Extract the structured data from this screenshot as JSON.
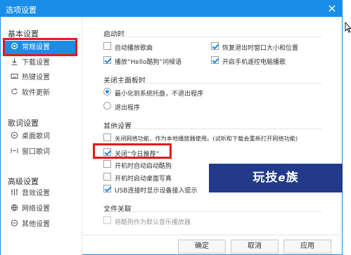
{
  "window": {
    "title": "选项设置"
  },
  "sidebar": {
    "groups": [
      {
        "label": "基本设置",
        "items": [
          {
            "label": "常规设置",
            "icon": "gear-icon",
            "active": true
          },
          {
            "label": "下载设置",
            "icon": "download-icon"
          },
          {
            "label": "热键设置",
            "icon": "keyboard-icon"
          },
          {
            "label": "软件更新",
            "icon": "update-icon"
          }
        ]
      },
      {
        "label": "歌词设置",
        "items": [
          {
            "label": "桌面歌词",
            "icon": "desktop-lyrics-icon"
          },
          {
            "label": "窗口歌词",
            "icon": "window-lyrics-icon"
          }
        ]
      },
      {
        "label": "高级设置",
        "items": [
          {
            "label": "音效设置",
            "icon": "equalizer-icon"
          },
          {
            "label": "网络设置",
            "icon": "network-icon"
          },
          {
            "label": "其他设置",
            "icon": "more-icon"
          }
        ]
      }
    ]
  },
  "main": {
    "startup": {
      "title": "启动时",
      "options": [
        {
          "label": "自动播放歌曲",
          "checked": false
        },
        {
          "label": "恢复退出时窗口大小和位置",
          "checked": true
        },
        {
          "label": "播放“Hello酷狗”问候语",
          "checked": true
        },
        {
          "label": "开启手机遥控电脑播歌",
          "checked": true
        }
      ]
    },
    "close_panel": {
      "title": "关闭主面板时",
      "options": [
        {
          "label": "最小化到系统托盘，不退出程序",
          "selected": true
        },
        {
          "label": "退出程序",
          "selected": false
        }
      ]
    },
    "other": {
      "title": "其他设置",
      "options": [
        {
          "label": "关闭网络功能，作为本地播放器使用。(试听和下载会重新打开网络功能)",
          "checked": false
        },
        {
          "label": "关闭“今日推荐”",
          "checked": true
        },
        {
          "label": "开机时自动启动酷狗",
          "checked": false
        },
        {
          "label": "开机时启动桌面写真",
          "checked": false
        },
        {
          "label": "USB连接时显示设备接入提示",
          "checked": true
        }
      ]
    },
    "file_assoc": {
      "title": "文件关联",
      "options": [
        {
          "label": "将酷狗作为默认音乐播放器",
          "checked": false,
          "disabled": true
        }
      ]
    }
  },
  "footer": {
    "ok": "确定",
    "cancel": "取消",
    "apply": "应用"
  },
  "watermark": {
    "text_a": "玩技",
    "text_b": "e",
    "text_c": "族"
  },
  "colors": {
    "accent": "#1a8ee6",
    "highlight": "#e11b1b"
  }
}
